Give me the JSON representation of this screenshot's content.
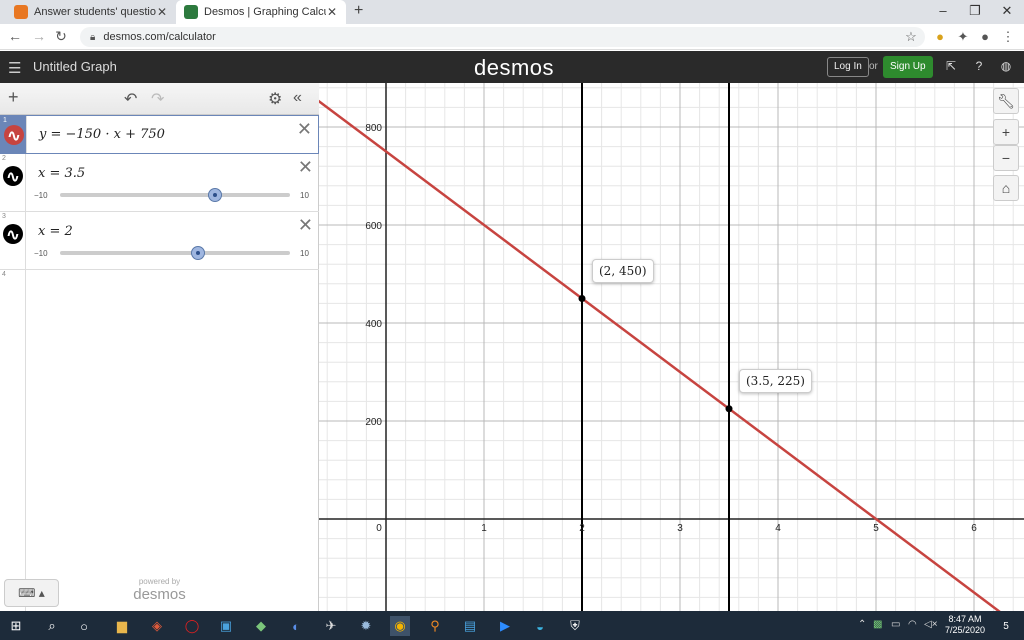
{
  "browser": {
    "tabs": [
      {
        "title": "Answer students' questions and",
        "favicon": "chegg-icon",
        "active": false
      },
      {
        "title": "Desmos | Graphing Calculator",
        "favicon": "desmos-icon",
        "active": true
      }
    ],
    "new_tab": "+",
    "url": "desmos.com/calculator",
    "window_controls": {
      "minimize": "–",
      "restore": "❐",
      "close": "✕"
    }
  },
  "header": {
    "graph_title": "Untitled Graph",
    "logo": "desmos",
    "login": "Log In",
    "or": "or",
    "signup": "Sign Up"
  },
  "expressions": [
    {
      "index": "1",
      "latex_text": "y = −150 · x + 750",
      "color": "#c74440",
      "selected": true
    },
    {
      "index": "2",
      "latex_text": "x = 3.5",
      "color": "#000000",
      "slider": {
        "min": "−10",
        "max": "10",
        "value": 3.5
      }
    },
    {
      "index": "3",
      "latex_text": "x = 2",
      "color": "#000000",
      "slider": {
        "min": "−10",
        "max": "10",
        "value": 2
      }
    },
    {
      "index": "4"
    }
  ],
  "footer": {
    "powered_by": "powered by",
    "logo": "desmos",
    "keypad_icon": "keyboard-icon"
  },
  "graph": {
    "x_ticks": [
      "0",
      "1",
      "2",
      "3",
      "4",
      "5",
      "6"
    ],
    "y_ticks": [
      "200",
      "400",
      "600",
      "800"
    ],
    "point_labels": [
      "(2, 450)",
      "(3.5, 225)"
    ],
    "line_color": "#c74440"
  },
  "chart_data": {
    "type": "line",
    "series": [
      {
        "name": "y = −150 · x + 750",
        "x": [
          -0.7,
          6.3
        ],
        "y": [
          855,
          -195
        ]
      }
    ],
    "vertical_lines": [
      2,
      3.5
    ],
    "points": [
      {
        "x": 2,
        "y": 450,
        "label": "(2, 450)"
      },
      {
        "x": 3.5,
        "y": 225,
        "label": "(3.5, 225)"
      }
    ],
    "xlim": [
      -0.7,
      6.5
    ],
    "ylim": [
      -190,
      880
    ],
    "grid": true,
    "xticks": [
      0,
      1,
      2,
      3,
      4,
      5,
      6
    ],
    "yticks": [
      200,
      400,
      600,
      800
    ]
  },
  "taskbar": {
    "time": "8:47 AM",
    "date": "7/25/2020",
    "notifications": "5"
  }
}
